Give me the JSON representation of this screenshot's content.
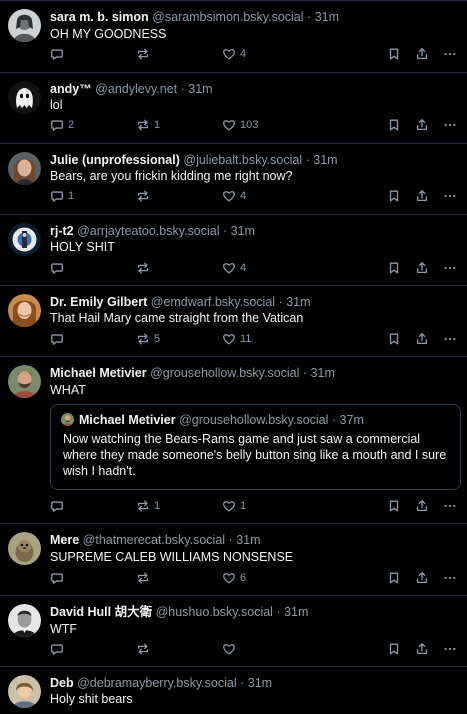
{
  "posts": [
    {
      "name": "sara m. b. simon",
      "handle": "@sarambsimon.bsky.social",
      "sep": "·",
      "time": "31m",
      "text": "OH MY GOODNESS",
      "replies": "",
      "reposts": "",
      "likes": "4"
    },
    {
      "name": "andy™",
      "handle": "@andylevy.net",
      "sep": "·",
      "time": "31m",
      "text": "lol",
      "replies": "2",
      "reposts": "1",
      "likes": "103"
    },
    {
      "name": "Julie (unprofessional)",
      "handle": "@juliebalt.bsky.social",
      "sep": "·",
      "time": "31m",
      "text": "Bears, are you frickin kidding me right now?",
      "replies": "1",
      "reposts": "",
      "likes": "4"
    },
    {
      "name": "rj-t2",
      "handle": "@arrjayteatoo.bsky.social",
      "sep": "·",
      "time": "31m",
      "text": "HOLY SHIT",
      "replies": "",
      "reposts": "",
      "likes": "4"
    },
    {
      "name": "Dr. Emily Gilbert",
      "handle": "@emdwarf.bsky.social",
      "sep": "·",
      "time": "31m",
      "text": "That Hail Mary came straight from the Vatican",
      "replies": "",
      "reposts": "5",
      "likes": "11"
    },
    {
      "name": "Michael Metivier",
      "handle": "@grousehollow.bsky.social",
      "sep": "·",
      "time": "31m",
      "text": "WHAT",
      "replies": "",
      "reposts": "1",
      "likes": "1",
      "quote": {
        "name": "Michael Metivier",
        "handle": "@grousehollow.bsky.social",
        "sep": "·",
        "time": "37m",
        "text": " Now watching the Bears-Rams game and just saw a commercial where they made someone's belly button sing like a mouth and I sure wish I hadn't."
      }
    },
    {
      "name": "Mere",
      "handle": "@thatmerecat.bsky.social",
      "sep": "·",
      "time": "31m",
      "text": "SUPREME CALEB WILLIAMS NONSENSE",
      "replies": "",
      "reposts": "",
      "likes": "6"
    },
    {
      "name": "David Hull 胡大衛",
      "handle": "@hushuo.bsky.social",
      "sep": "·",
      "time": "31m",
      "text": "WTF",
      "replies": "",
      "reposts": "",
      "likes": ""
    },
    {
      "name": "Deb",
      "handle": "@debramayberry.bsky.social",
      "sep": "·",
      "time": "31m",
      "text": "Holy shit bears"
    }
  ],
  "icons": {
    "reply": "speech-bubble-icon",
    "repost": "repost-arrows-icon",
    "like": "heart-icon",
    "bookmark": "bookmark-icon",
    "share": "share-icon",
    "more": "more-dots-icon"
  },
  "colors": {
    "background": "#000000",
    "divider": "#1e2937",
    "text": "#f1f3f5",
    "muted": "#8b98a5"
  }
}
